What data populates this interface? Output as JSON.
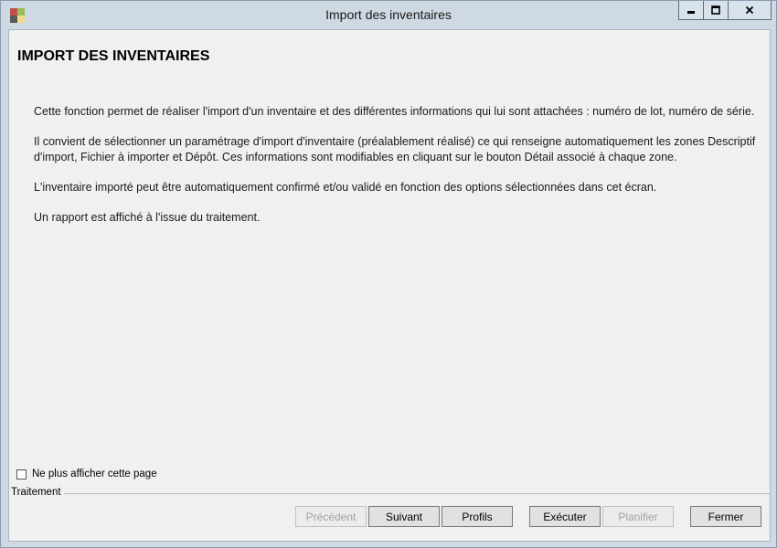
{
  "window": {
    "title": "Import des inventaires",
    "icon": "app-icon",
    "controls": {
      "minimize": "minimize-icon",
      "maximize": "maximize-icon",
      "close": "close-icon"
    }
  },
  "page": {
    "heading": "IMPORT DES INVENTAIRES",
    "paragraphs": [
      "Cette fonction permet de réaliser l'import d'un inventaire et des différentes informations qui lui sont attachées : numéro de lot, numéro de série.",
      "Il convient de sélectionner un paramétrage d'import d'inventaire (préalablement réalisé) ce qui renseigne automatiquement les zones Descriptif d'import, Fichier à importer et Dépôt. Ces informations sont modifiables en cliquant sur le bouton Détail associé à chaque zone.",
      "L'inventaire importé peut être automatiquement confirmé et/ou validé en fonction des options sélectionnées dans cet écran.",
      "Un rapport est affiché à l'issue du traitement."
    ],
    "dont_show_label": "Ne plus afficher cette page",
    "dont_show_checked": false,
    "group_label": "Traitement"
  },
  "buttons": {
    "precedent": {
      "label": "Précédent",
      "enabled": false
    },
    "suivant": {
      "label": "Suivant",
      "enabled": true
    },
    "profils": {
      "label": "Profils",
      "enabled": true
    },
    "executer": {
      "label": "Exécuter",
      "enabled": true
    },
    "planifier": {
      "label": "Planifier",
      "enabled": false
    },
    "fermer": {
      "label": "Fermer",
      "enabled": true
    }
  }
}
